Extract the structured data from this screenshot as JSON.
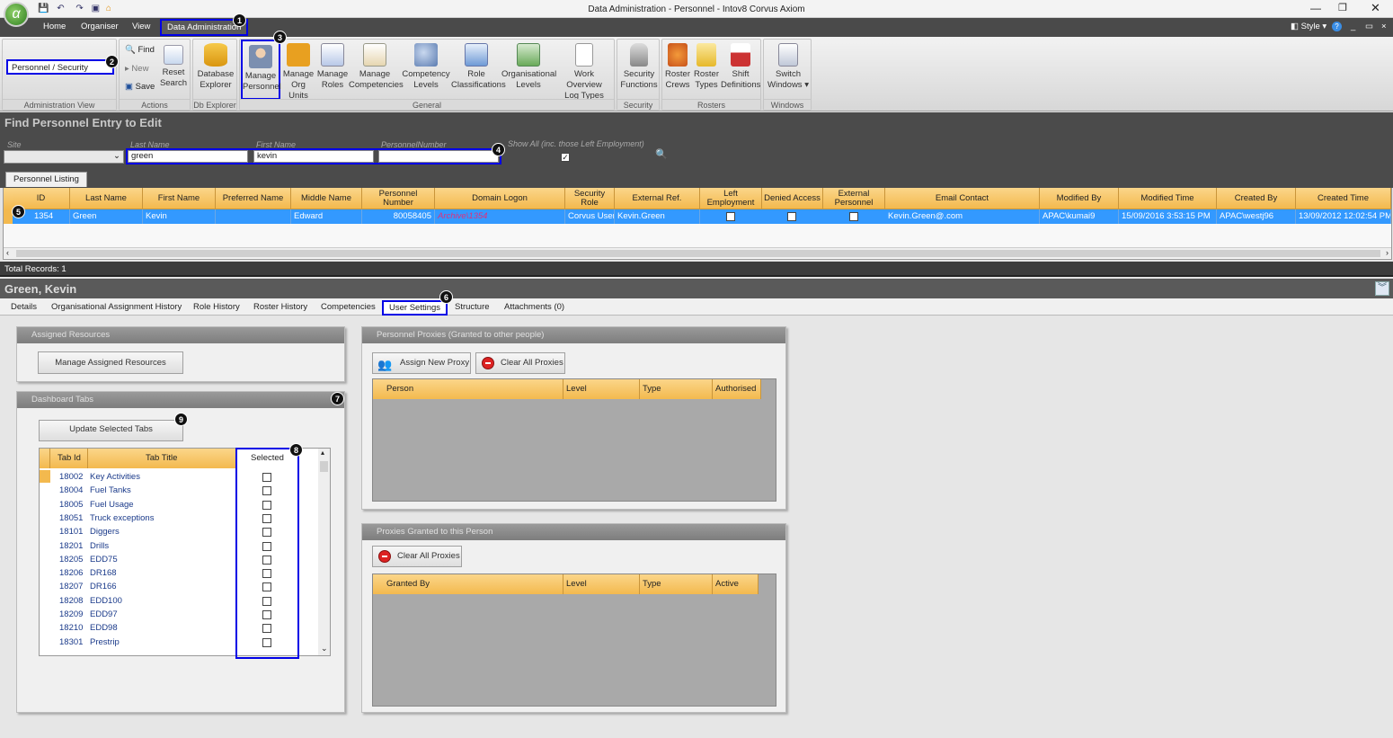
{
  "window": {
    "title": "Data Administration - Personnel - Intov8 Corvus Axiom",
    "style_label": "Style",
    "help": "?"
  },
  "menu": {
    "items": [
      "Home",
      "Organiser",
      "View",
      "Data Administration"
    ]
  },
  "ribbon": {
    "admin_view_value": "Personnel / Security",
    "groups": {
      "admin_view": "Administration View",
      "actions": "Actions",
      "db_explorer": "Db Explorer",
      "general": "General",
      "security": "Security",
      "rosters": "Rosters",
      "windows": "Windows"
    },
    "actions": {
      "find": "Find",
      "new": "New",
      "save": "Save",
      "reset_search_1": "Reset",
      "reset_search_2": "Search"
    },
    "buttons": [
      {
        "l1": "Database",
        "l2": "Explorer"
      },
      {
        "l1": "Manage",
        "l2": "Personnel"
      },
      {
        "l1": "Manage",
        "l2": "Org Units"
      },
      {
        "l1": "Manage",
        "l2": "Roles"
      },
      {
        "l1": "Manage",
        "l2": "Competencies"
      },
      {
        "l1": "Competency",
        "l2": "Levels"
      },
      {
        "l1": "Role",
        "l2": "Classifications"
      },
      {
        "l1": "Organisational",
        "l2": "Levels"
      },
      {
        "l1": "Work Overview",
        "l2": "Log Types"
      },
      {
        "l1": "Security",
        "l2": "Functions"
      },
      {
        "l1": "Roster",
        "l2": "Crews"
      },
      {
        "l1": "Roster",
        "l2": "Types"
      },
      {
        "l1": "Shift",
        "l2": "Definitions"
      },
      {
        "l1": "Switch",
        "l2": "Windows ▾"
      }
    ]
  },
  "find": {
    "title": "Find Personnel Entry to Edit",
    "site_label": "Site",
    "last_name_label": "Last Name",
    "first_name_label": "First Name",
    "personnel_number_label": "PersonnelNumber",
    "show_all_label": "Show All (inc. those Left Employment)",
    "last_name_value": "green",
    "first_name_value": "kevin",
    "personnel_number_value": ""
  },
  "listing": {
    "tab": "Personnel Listing",
    "columns": [
      "ID",
      "Last Name",
      "First Name",
      "Preferred Name",
      "Middle Name",
      "Personnel Number",
      "Domain Logon",
      "Security Role",
      "External Ref.",
      "Left Employment",
      "Denied Access",
      "External Personnel",
      "Email Contact",
      "Modified By",
      "Modified Time",
      "Created By",
      "Created Time"
    ],
    "row": {
      "id": "1354",
      "last_name": "Green",
      "first_name": "Kevin",
      "preferred_name": "",
      "middle_name": "Edward",
      "personnel_number": "80058405",
      "domain_logon": "Archive\\1354",
      "security_role": "Corvus User",
      "external_ref": "Kevin.Green",
      "email": "Kevin.Green@.com",
      "modified_by": "APAC\\kumai9",
      "modified_time": "15/09/2016 3:53:15 PM",
      "created_by": "APAC\\westj96",
      "created_time": "13/09/2012 12:02:54 PM"
    },
    "total": "Total Records: 1"
  },
  "detail": {
    "person_name": "Green, Kevin",
    "tabs": [
      "Details",
      "Organisational Assignment History",
      "Role History",
      "Roster History",
      "Competencies",
      "User Settings",
      "Structure",
      "Attachments (0)"
    ]
  },
  "assigned_resources": {
    "title": "Assigned Resources",
    "button": "Manage Assigned Resources"
  },
  "dashboard_tabs": {
    "title": "Dashboard Tabs",
    "update_button": "Update Selected Tabs",
    "columns": [
      "Tab Id",
      "Tab Title",
      "Selected"
    ],
    "rows": [
      {
        "id": "18002",
        "title": "Key Activities"
      },
      {
        "id": "18004",
        "title": "Fuel Tanks"
      },
      {
        "id": "18005",
        "title": "Fuel Usage"
      },
      {
        "id": "18051",
        "title": "Truck exceptions"
      },
      {
        "id": "18101",
        "title": "Diggers"
      },
      {
        "id": "18201",
        "title": "Drills"
      },
      {
        "id": "18205",
        "title": "EDD75"
      },
      {
        "id": "18206",
        "title": "DR168"
      },
      {
        "id": "18207",
        "title": "DR166"
      },
      {
        "id": "18208",
        "title": "EDD100"
      },
      {
        "id": "18209",
        "title": "EDD97"
      },
      {
        "id": "18210",
        "title": "EDD98"
      },
      {
        "id": "18301",
        "title": "Prestrip"
      }
    ]
  },
  "proxies_granted_other": {
    "title": "Personnel Proxies (Granted to other people)",
    "assign_button": "Assign New Proxy",
    "clear_button": "Clear All Proxies",
    "columns": [
      "Person",
      "Level",
      "Type",
      "Authorised"
    ]
  },
  "proxies_granted_this": {
    "title": "Proxies Granted to this Person",
    "clear_button": "Clear All Proxies",
    "columns": [
      "Granted By",
      "Level",
      "Type",
      "Active"
    ]
  },
  "badges": [
    "1",
    "2",
    "3",
    "4",
    "5",
    "6",
    "7",
    "8",
    "9"
  ],
  "colors": {
    "accent_highlight": "#0000e6",
    "selected_row": "#3399ff",
    "grid_header": "#f3b94e",
    "dark_header": "#4b4b4b"
  }
}
